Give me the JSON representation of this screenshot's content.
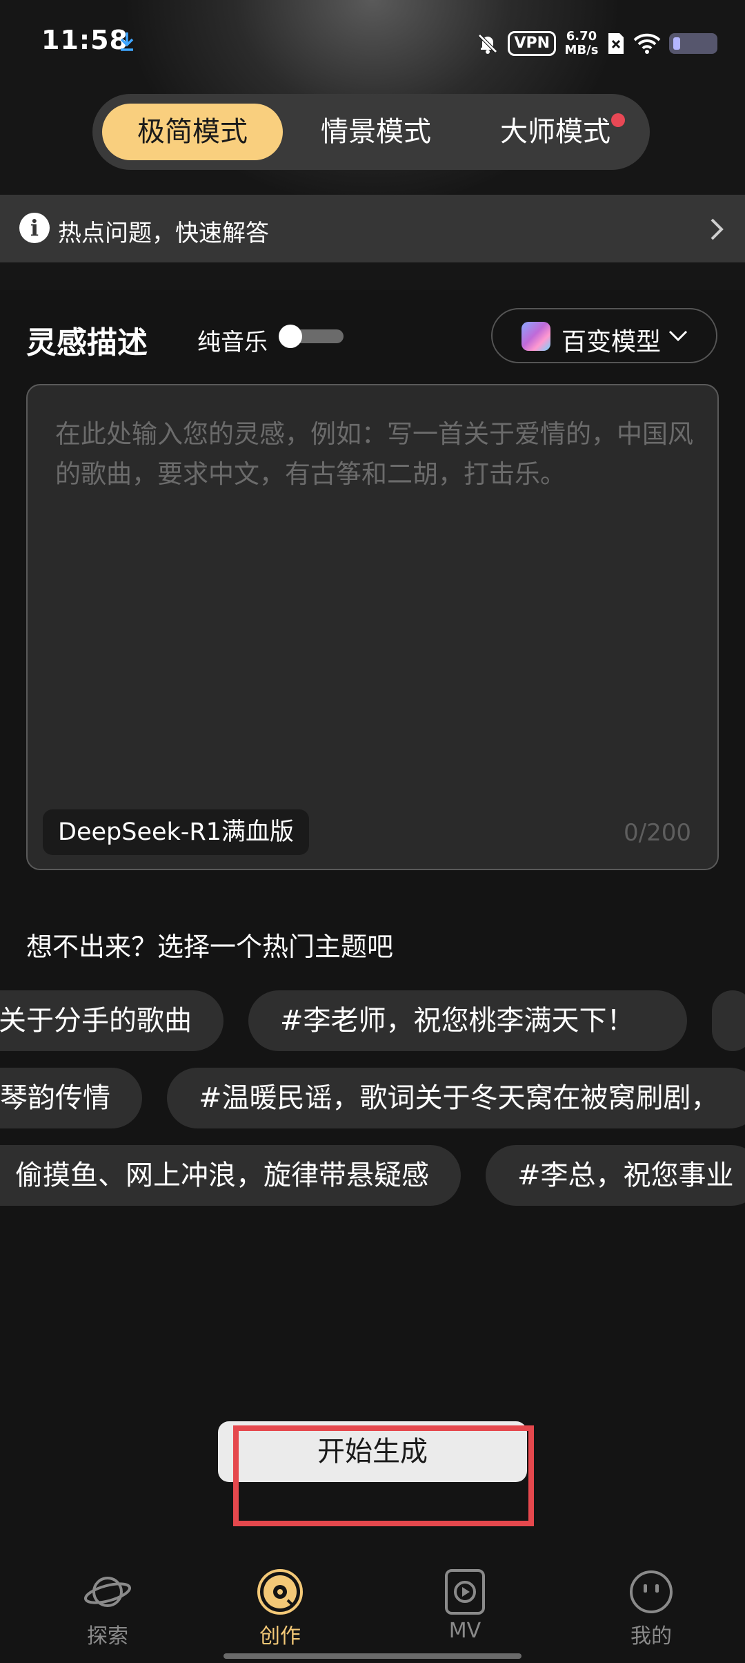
{
  "status": {
    "time": "11:58",
    "vpn": "VPN",
    "speed_value": "6.70",
    "speed_unit": "MB/s"
  },
  "modes": [
    {
      "label": "极简模式",
      "active": true
    },
    {
      "label": "情景模式",
      "active": false
    },
    {
      "label": "大师模式",
      "active": false,
      "badge": true
    }
  ],
  "notice": {
    "text": "热点问题，快速解答"
  },
  "inspiration": {
    "title": "灵感描述",
    "pure_music_label": "纯音乐",
    "pure_music_on": false,
    "model_label": "百变模型",
    "placeholder": "在此处输入您的灵感，例如：写一首关于爱情的，中国风的歌曲，要求中文，有古筝和二胡，打击乐。",
    "model_badge": "DeepSeek-R1满血版",
    "counter": "0/200"
  },
  "topics": {
    "title": "想不出来？选择一个热门主题吧",
    "chips": [
      "关于分手的歌曲",
      "#李老师，祝您桃李满天下！",
      "琴韵传情",
      "#温暖民谣，歌词关于冬天窝在被窝刷剧，",
      "偷摸鱼、网上冲浪，旋律带悬疑感",
      "#李总，祝您事业"
    ]
  },
  "generate_button": "开始生成",
  "nav": [
    {
      "label": "探索",
      "icon": "planet-icon",
      "active": false
    },
    {
      "label": "创作",
      "icon": "vinyl-icon",
      "active": true
    },
    {
      "label": "MV",
      "icon": "play-box-icon",
      "active": false
    },
    {
      "label": "我的",
      "icon": "face-icon",
      "active": false
    }
  ],
  "colors": {
    "accent": "#f9cf7e",
    "active_nav": "#f3c877",
    "highlight": "#e5484d",
    "badge_dot": "#e84855"
  }
}
